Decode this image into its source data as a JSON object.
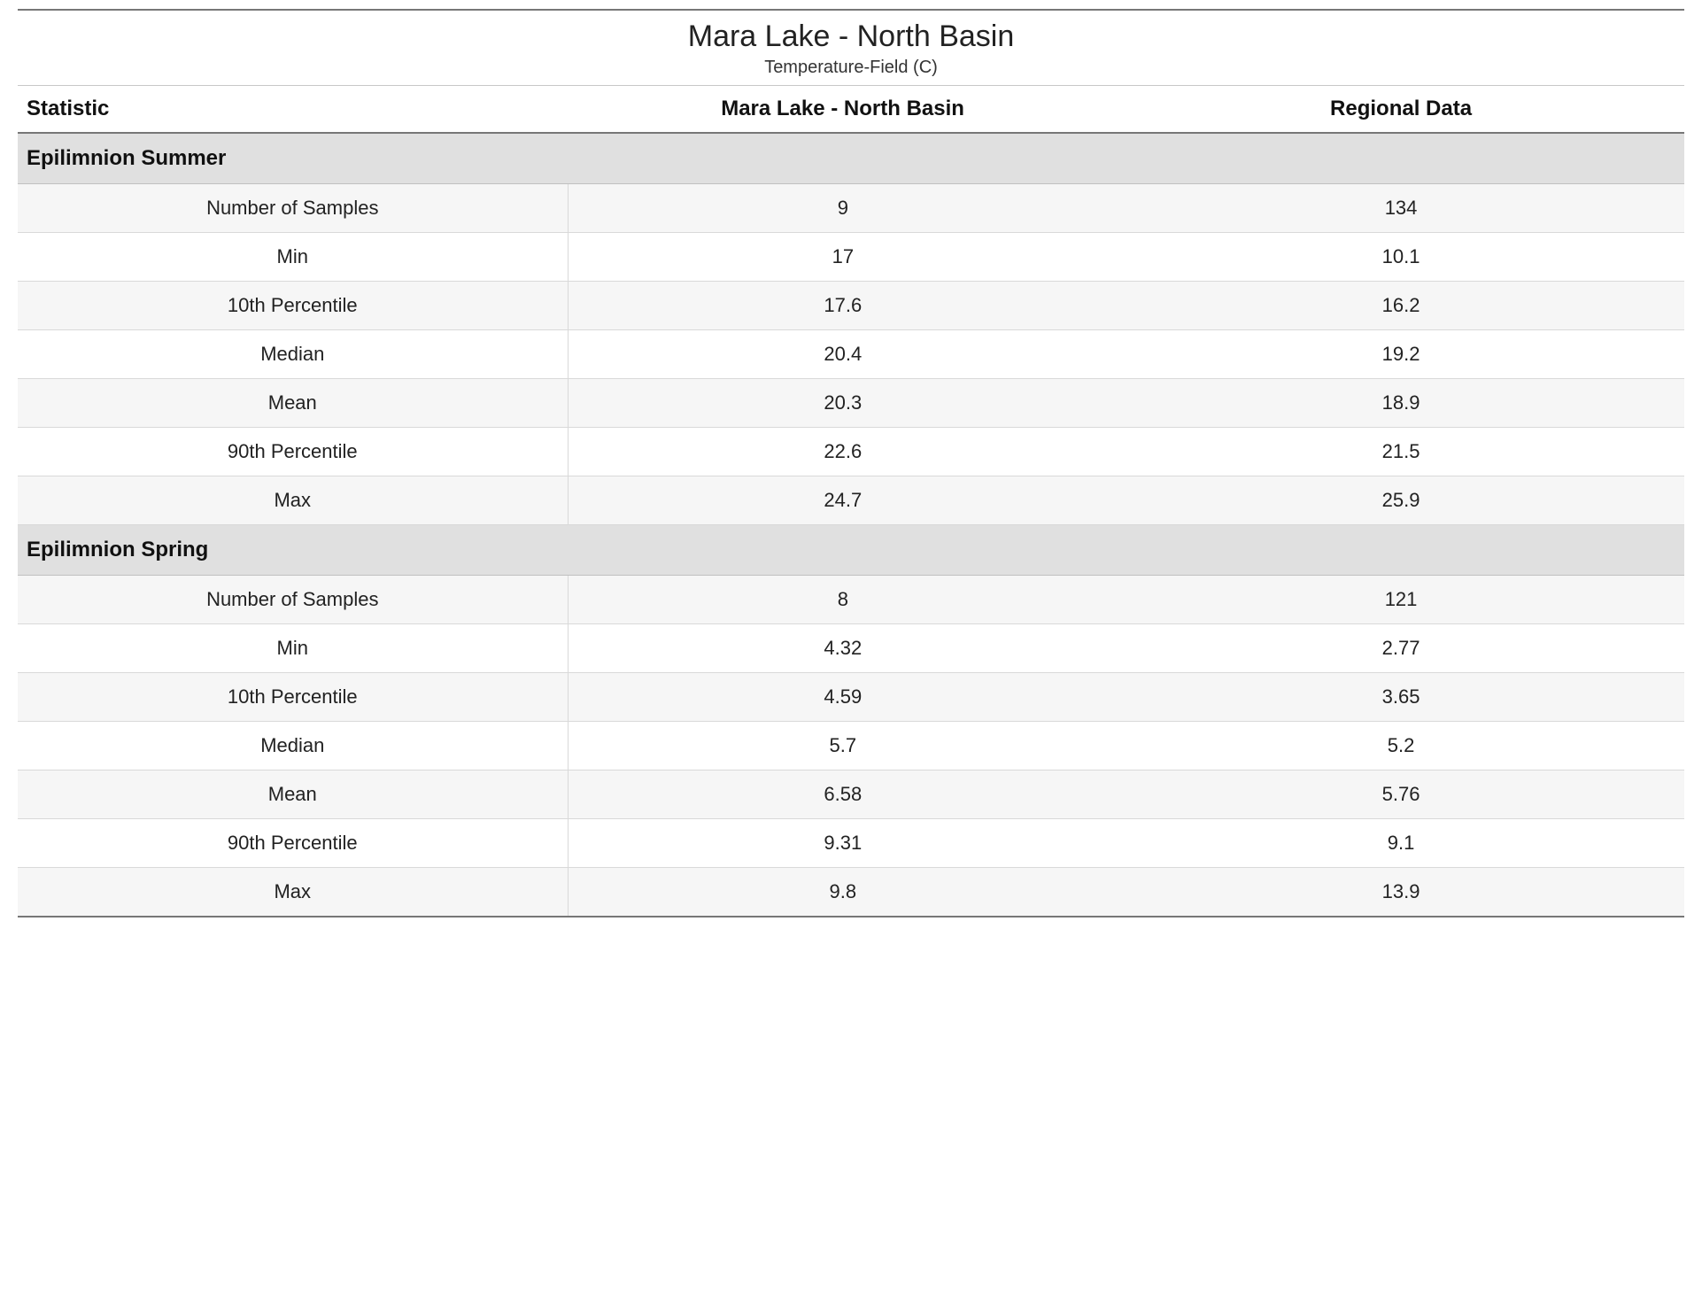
{
  "header": {
    "title": "Mara Lake - North Basin",
    "subtitle": "Temperature-Field (C)"
  },
  "columns": {
    "statistic": "Statistic",
    "site": "Mara Lake - North Basin",
    "region": "Regional Data"
  },
  "sections": [
    {
      "name": "Epilimnion Summer",
      "rows": [
        {
          "stat": "Number of Samples",
          "site": "9",
          "region": "134"
        },
        {
          "stat": "Min",
          "site": "17",
          "region": "10.1"
        },
        {
          "stat": "10th Percentile",
          "site": "17.6",
          "region": "16.2"
        },
        {
          "stat": "Median",
          "site": "20.4",
          "region": "19.2"
        },
        {
          "stat": "Mean",
          "site": "20.3",
          "region": "18.9"
        },
        {
          "stat": "90th Percentile",
          "site": "22.6",
          "region": "21.5"
        },
        {
          "stat": "Max",
          "site": "24.7",
          "region": "25.9"
        }
      ]
    },
    {
      "name": "Epilimnion Spring",
      "rows": [
        {
          "stat": "Number of Samples",
          "site": "8",
          "region": "121"
        },
        {
          "stat": "Min",
          "site": "4.32",
          "region": "2.77"
        },
        {
          "stat": "10th Percentile",
          "site": "4.59",
          "region": "3.65"
        },
        {
          "stat": "Median",
          "site": "5.7",
          "region": "5.2"
        },
        {
          "stat": "Mean",
          "site": "6.58",
          "region": "5.76"
        },
        {
          "stat": "90th Percentile",
          "site": "9.31",
          "region": "9.1"
        },
        {
          "stat": "Max",
          "site": "9.8",
          "region": "13.9"
        }
      ]
    }
  ]
}
